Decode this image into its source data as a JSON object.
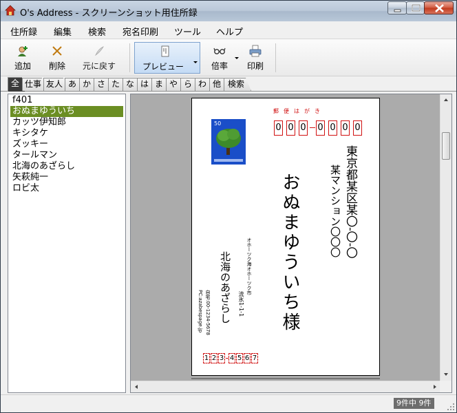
{
  "window": {
    "title": "O's Address - スクリーンショット用住所録"
  },
  "menu": [
    "住所録",
    "編集",
    "検索",
    "宛名印刷",
    "ツール",
    "ヘルプ"
  ],
  "toolbar": {
    "add": "追加",
    "delete": "削除",
    "undo": "元に戻す",
    "preview": "プレビュー",
    "zoom": "倍率",
    "print": "印刷"
  },
  "tabs": [
    "全",
    "仕事",
    "友人",
    "あ",
    "か",
    "さ",
    "た",
    "な",
    "は",
    "ま",
    "や",
    "ら",
    "わ",
    "他",
    "検索"
  ],
  "selected_tab": "全",
  "list": {
    "header": "f401",
    "items": [
      "おぬまゆういち",
      "カッツ伊知郎",
      "キシタケ",
      "ズッキー",
      "タールマン",
      "北海のあざらし",
      "矢萩純一",
      "ロビ太"
    ],
    "selected_index": 0
  },
  "postcard": {
    "heading": "郵便はがき",
    "stamp_value": "50",
    "zip": [
      "0",
      "0",
      "0",
      "0",
      "0",
      "0",
      "0"
    ],
    "recipient_address1": "東京都某区某〇-〇-〇",
    "recipient_address2": "某マンション〇〇〇",
    "recipient_name": "おぬまゆういち様",
    "sender_address1": "オホーツク海オホーツク市",
    "sender_address2": "流氷1-1-1",
    "sender_name": "北海のあざらし",
    "sender_tel": "自宅:00-1234-5678",
    "sender_pc": "PC:azabespage.jp",
    "sender_zip": [
      "1",
      "2",
      "3",
      "4",
      "5",
      "6",
      "7"
    ]
  },
  "status": {
    "count": "9件中 9件"
  },
  "colors": {
    "selection": "#6b8e23",
    "postcard_red": "#d01010",
    "stamp_blue": "#1a4ec8"
  }
}
